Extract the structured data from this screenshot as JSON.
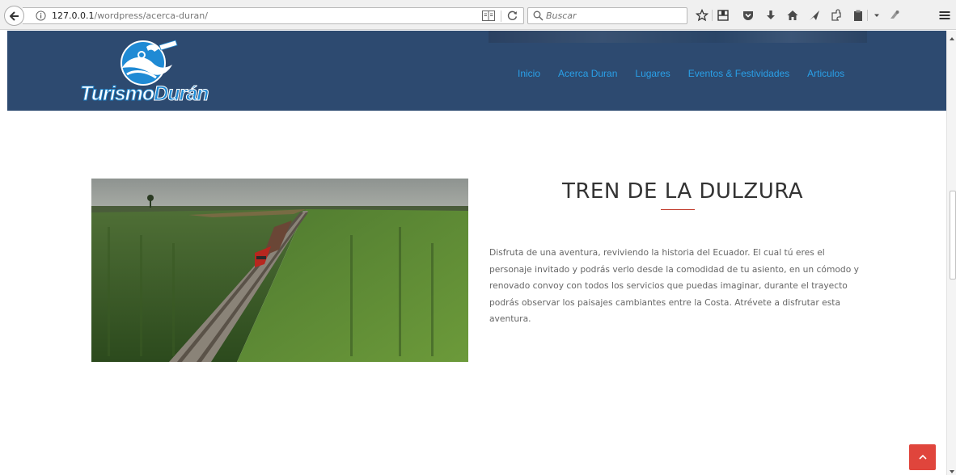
{
  "browser": {
    "url_host": "127.0.0.1",
    "url_path": "/wordpress/acerca-duran/",
    "search_placeholder": "Buscar"
  },
  "site": {
    "logo_text_1": "Turismo",
    "logo_text_2": "Durán",
    "nav": [
      "Inicio",
      "Acerca Duran",
      "Lugares",
      "Eventos & Festividades",
      "Articulos"
    ]
  },
  "main": {
    "title": "TREN DE LA DULZURA",
    "description": "Disfruta de una aventura, reviviendo la historia del Ecuador. El cual tú eres el personaje invitado y podrás verlo desde la comodidad de tu asiento, en un cómodo y renovado convoy con todos los servicios que puedas imaginar, durante el trayecto podrás observar los paisajes cambiantes entre la Costa.  Atrévete a disfrutar esta aventura."
  },
  "colors": {
    "header_bg": "#2d4a70",
    "nav_link": "#2aa0e8",
    "accent_red": "#e0453c",
    "title_line": "#c0392b"
  }
}
